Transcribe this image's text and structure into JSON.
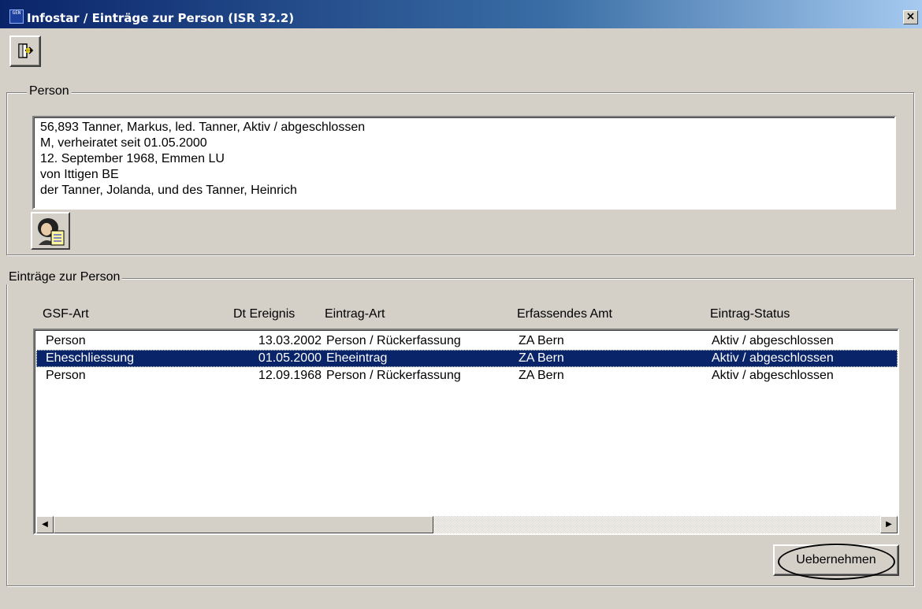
{
  "window": {
    "title": "Infostar / Einträge zur Person (ISR 32.2)",
    "app_icon_text": "GEN",
    "close_glyph": "×"
  },
  "toolbar": {
    "exit_icon": "exit-door-icon"
  },
  "person": {
    "group_label": "Person",
    "lines": [
      "56,893  Tanner, Markus, led. Tanner, Aktiv / abgeschlossen",
      "M, verheiratet seit 01.05.2000",
      "12. September 1968, Emmen LU",
      "von Ittigen BE",
      "der Tanner, Jolanda, und des Tanner, Heinrich"
    ],
    "photo_icon": "person-photo-icon"
  },
  "entries": {
    "group_label": "Einträge zur Person",
    "columns": [
      "GSF-Art",
      "Dt Ereignis",
      "Eintrag-Art",
      "Erfassendes Amt",
      "Eintrag-Status"
    ],
    "rows": [
      {
        "gsf_art": "Person",
        "dt_ereignis": "13.03.2002",
        "eintrag_art": "Person / Rückerfassung",
        "amt": "ZA Bern",
        "status": "Aktiv / abgeschlossen",
        "selected": false
      },
      {
        "gsf_art": "Eheschliessung",
        "dt_ereignis": "01.05.2000",
        "eintrag_art": "Eheeintrag",
        "amt": "ZA Bern",
        "status": "Aktiv / abgeschlossen",
        "selected": true
      },
      {
        "gsf_art": "Person",
        "dt_ereignis": "12.09.1968",
        "eintrag_art": "Person / Rückerfassung",
        "amt": "ZA Bern",
        "status": "Aktiv / abgeschlossen",
        "selected": false
      }
    ],
    "scroll_left_glyph": "◀",
    "scroll_right_glyph": "▶"
  },
  "actions": {
    "uebernehmen_label": "Uebernehmen"
  }
}
